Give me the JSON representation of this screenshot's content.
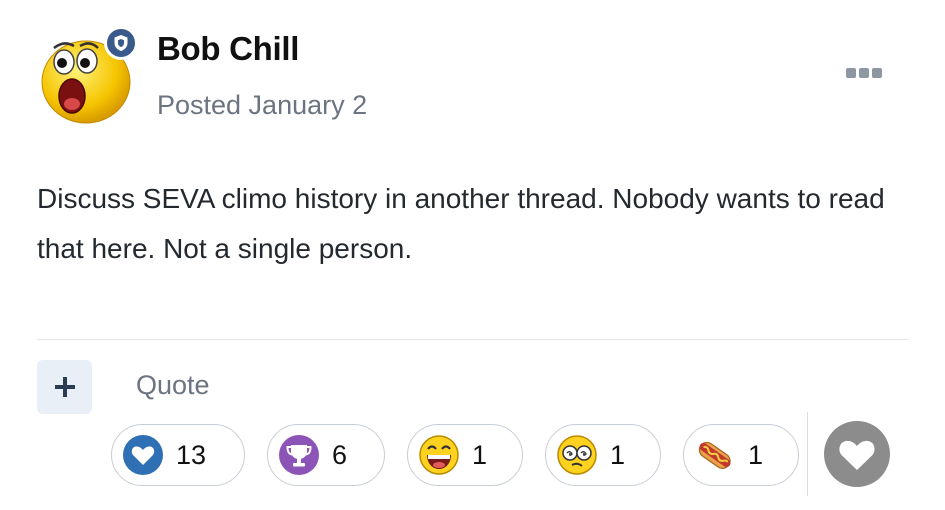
{
  "post": {
    "author": "Bob Chill",
    "posted": "Posted January 2",
    "body": "Discuss SEVA climo history in another thread. Nobody wants to read that here. Not a single person.",
    "badge_icon": "moderator-shield-icon",
    "menu_icon": "more-options-icon"
  },
  "actions": {
    "plus_icon": "plus-icon",
    "quote_label": "Quote"
  },
  "reactions": [
    {
      "icon": "like-heart-icon",
      "count": "13",
      "color": "#2f6fb3"
    },
    {
      "icon": "trophy-icon",
      "count": "6",
      "color": "#8b54b6"
    },
    {
      "icon": "laughing-face-icon",
      "count": "1"
    },
    {
      "icon": "confused-face-icon",
      "count": "1"
    },
    {
      "icon": "hotdog-icon",
      "count": "1"
    }
  ],
  "react_button_icon": "heart-icon",
  "colors": {
    "badge": "#3a5a8c",
    "muted_text": "#6b7480",
    "plus_bg": "#e9eff6",
    "react_button": "#8c8c8c"
  }
}
